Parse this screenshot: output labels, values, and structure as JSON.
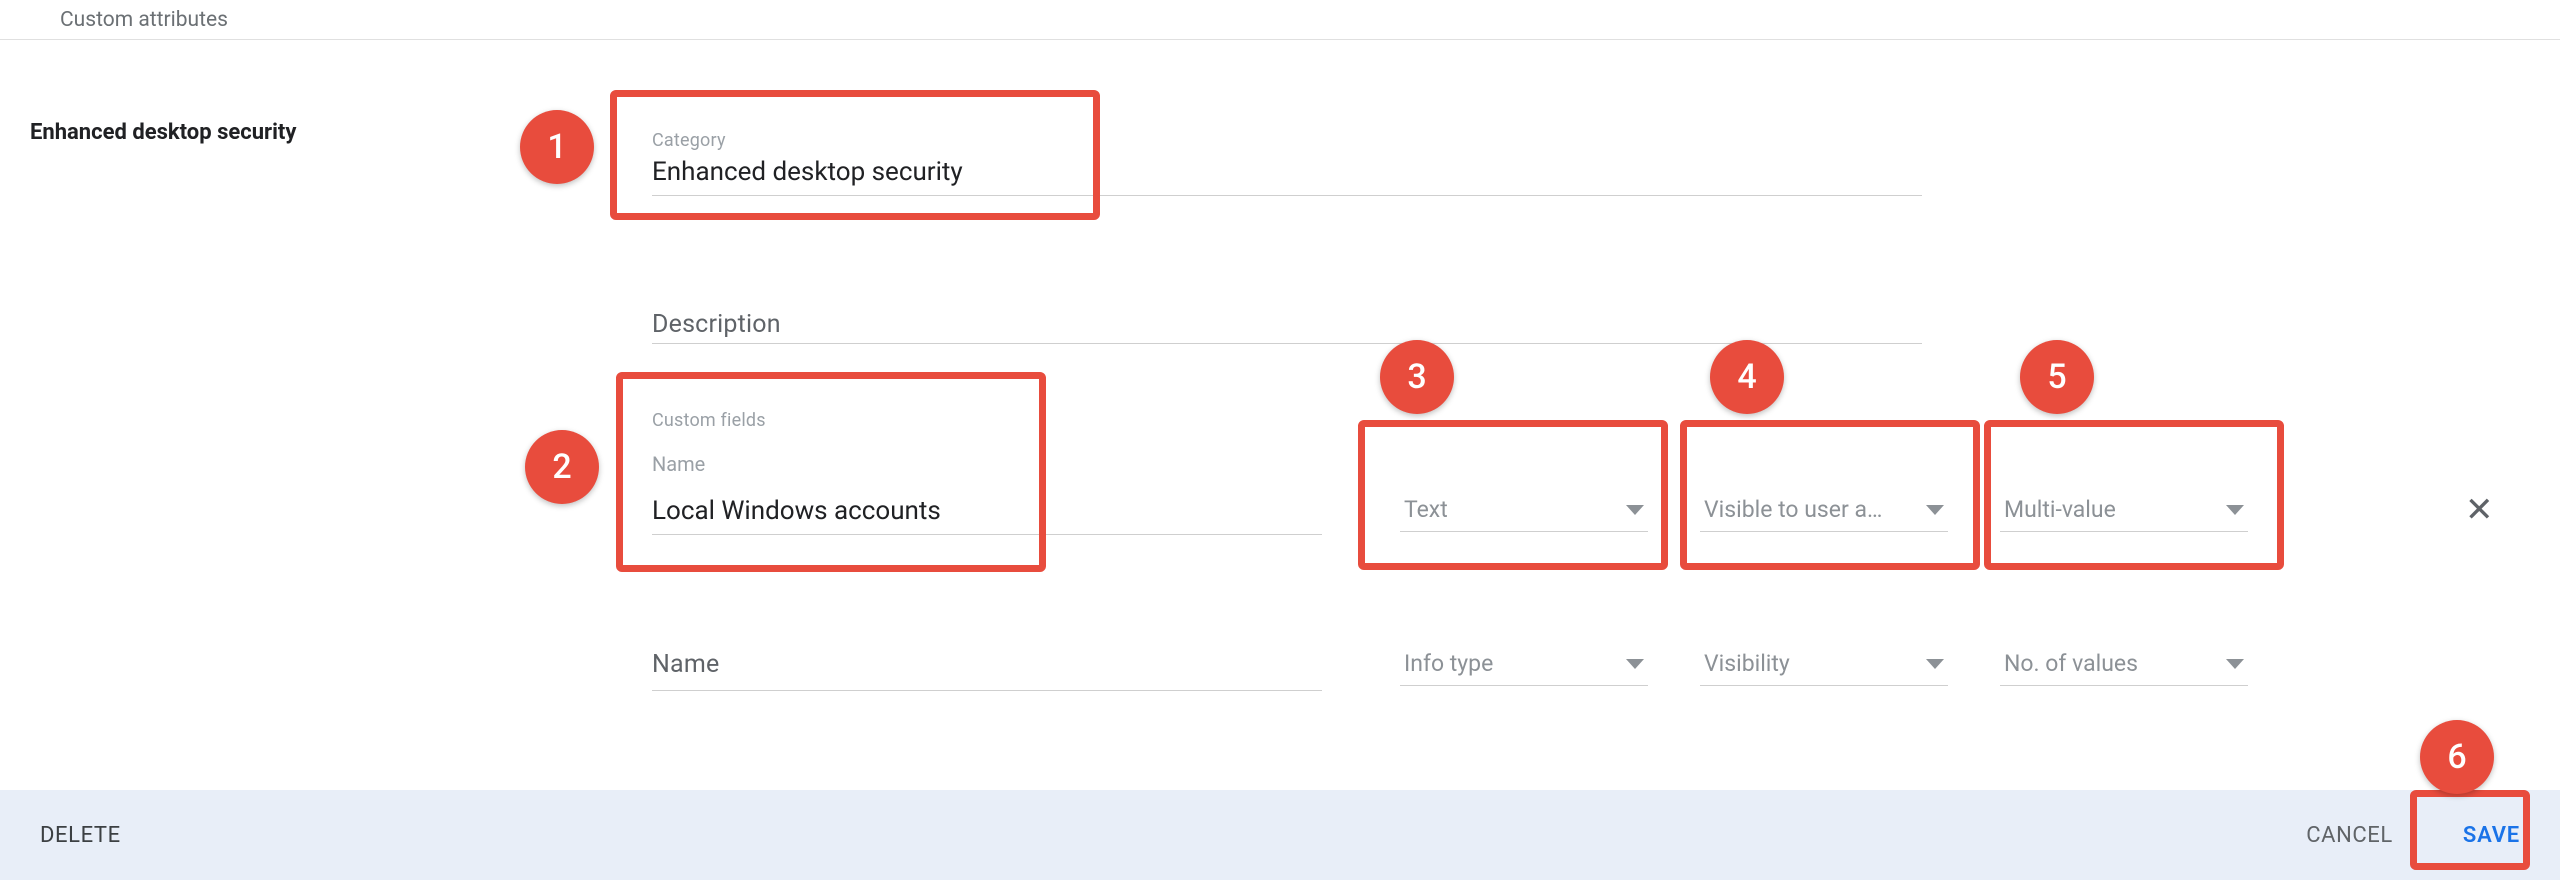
{
  "breadcrumb": "Custom attributes",
  "side_title": "Enhanced desktop security",
  "category": {
    "label": "Category",
    "value": "Enhanced desktop security"
  },
  "description_label": "Description",
  "custom_fields": {
    "section_label": "Custom fields",
    "name_label": "Name",
    "rows": [
      {
        "name_value": "Local Windows accounts",
        "info_type": "Text",
        "visibility": "Visible to user a…",
        "values_mode": "Multi-value"
      }
    ],
    "empty_row": {
      "name_placeholder": "Name",
      "info_type_placeholder": "Info type",
      "visibility_placeholder": "Visibility",
      "values_placeholder": "No. of values"
    }
  },
  "footer": {
    "delete": "DELETE",
    "cancel": "CANCEL",
    "save": "SAVE"
  },
  "annotations": {
    "1": "1",
    "2": "2",
    "3": "3",
    "4": "4",
    "5": "5",
    "6": "6"
  }
}
